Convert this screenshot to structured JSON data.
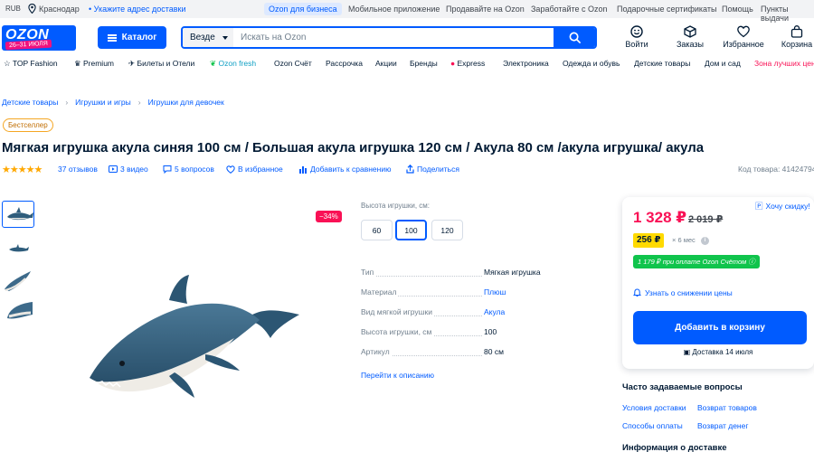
{
  "topbar": {
    "currency": "RUB",
    "city": "Краснодар",
    "address_prompt": "• Укажите адрес доставки",
    "business": "Ozon для бизнеса",
    "links": [
      "Мобильное приложение",
      "Продавайте на Ozon",
      "Заработайте с Ozon",
      "Подарочные сертификаты",
      "Помощь",
      "Пункты выдачи"
    ]
  },
  "header": {
    "logo": "OZON",
    "promo": "26–31 ИЮЛЯ",
    "catalog_label": "Каталог",
    "search_scope": "Везде",
    "search_placeholder": "Искать на Ozon",
    "icons": [
      {
        "label": "Войти",
        "icon": "smile-icon"
      },
      {
        "label": "Заказы",
        "icon": "box-icon"
      },
      {
        "label": "Избранное",
        "icon": "heart-icon"
      },
      {
        "label": "Корзина",
        "icon": "bag-icon"
      }
    ]
  },
  "nav": {
    "items": [
      "TOP Fashion",
      "Premium",
      "Билеты и Отели",
      "Ozon fresh",
      "Ozon Счёт",
      "Рассрочка",
      "Акции",
      "Бренды",
      "Express",
      "Электроника",
      "Одежда и обувь",
      "Детские товары",
      "Дом и сад",
      "Зона лучших цен"
    ]
  },
  "breadcrumbs": [
    "Детские товары",
    "Игрушки и игры",
    "Игрушки для девочек"
  ],
  "product": {
    "badge": "Бестселлер",
    "title": "Мягкая игрушка акула синяя 100 см / Большая акула игрушка 120 см / Акула 80 см /акула игрушка/ акула",
    "rating_stars": 5,
    "reviews": "37 отзывов",
    "videos": "3 видео",
    "questions": "5 вопросов",
    "favorite": "В избранное",
    "compare": "Добавить к сравнению",
    "share": "Поделиться",
    "code": "Код товара: 414247946",
    "discount": "−34%"
  },
  "options": {
    "label": "Высота игрушки, см:",
    "sizes": [
      "60",
      "100",
      "120"
    ],
    "selected": "100"
  },
  "specs": [
    {
      "key": "Тип",
      "value": "Мягкая игрушка",
      "link": false
    },
    {
      "key": "Материал",
      "value": "Плюш",
      "link": true
    },
    {
      "key": "Вид мягкой игрушки",
      "value": "Акула",
      "link": true
    },
    {
      "key": "Высота игрушки, см",
      "value": "100",
      "link": false
    },
    {
      "key": "Артикул",
      "value": "80 см",
      "link": false
    }
  ],
  "to_description": "Перейти к описанию",
  "price_card": {
    "price": "1 328 ₽",
    "old_price": "2 019 ₽",
    "installment": "256 ₽",
    "installment_term": "× 6 мес",
    "card_price": "1 179 ₽ при оплате Ozon Счётом",
    "notify": "Узнать о снижении цены",
    "cart_button": "Добавить в корзину",
    "delivery": "Доставка 14 июля",
    "want_discount": "Хочу скидку!"
  },
  "faq": {
    "title": "Часто задаваемые вопросы",
    "links": [
      "Условия доставки",
      "Возврат товаров",
      "Способы оплаты",
      "Возврат денег"
    ]
  },
  "delivery_info_title": "Информация о доставке",
  "colors": {
    "brand_blue": "#005bff",
    "price_red": "#f91155",
    "installment_yellow": "#ffda00",
    "card_green": "#10c44c"
  }
}
